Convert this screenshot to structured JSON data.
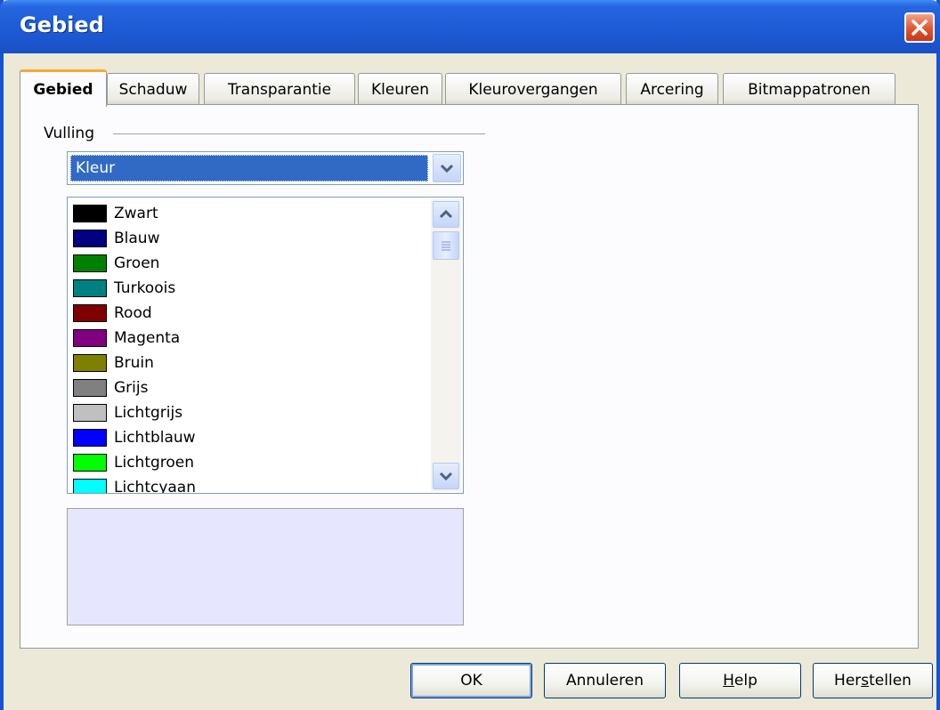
{
  "window": {
    "title": "Gebied"
  },
  "tabs": [
    {
      "label": "Gebied",
      "active": true
    },
    {
      "label": "Schaduw"
    },
    {
      "label": "Transparantie"
    },
    {
      "label": "Kleuren"
    },
    {
      "label": "Kleurovergangen"
    },
    {
      "label": "Arcering"
    },
    {
      "label": "Bitmappatronen"
    }
  ],
  "fill": {
    "group_label": "Vulling",
    "type_selected": "Kleur",
    "colors": [
      {
        "name": "Zwart",
        "color": "#000000"
      },
      {
        "name": "Blauw",
        "color": "#000080"
      },
      {
        "name": "Groen",
        "color": "#008000"
      },
      {
        "name": "Turkoois",
        "color": "#008080"
      },
      {
        "name": "Rood",
        "color": "#800000"
      },
      {
        "name": "Magenta",
        "color": "#800080"
      },
      {
        "name": "Bruin",
        "color": "#808000"
      },
      {
        "name": "Grijs",
        "color": "#808080"
      },
      {
        "name": "Lichtgrijs",
        "color": "#c0c0c0"
      },
      {
        "name": "Lichtblauw",
        "color": "#0000ff"
      },
      {
        "name": "Lichtgroen",
        "color": "#00ff00"
      },
      {
        "name": "Lichtcyaan",
        "color": "#00ffff"
      }
    ],
    "preview_color": "#e6e6ff"
  },
  "buttons": {
    "ok": "OK",
    "cancel": "Annuleren",
    "help_prefix": "",
    "help_mnemonic": "H",
    "help_rest": "elp",
    "reset_prefix": "Her",
    "reset_mnemonic": "s",
    "reset_rest": "tellen"
  }
}
